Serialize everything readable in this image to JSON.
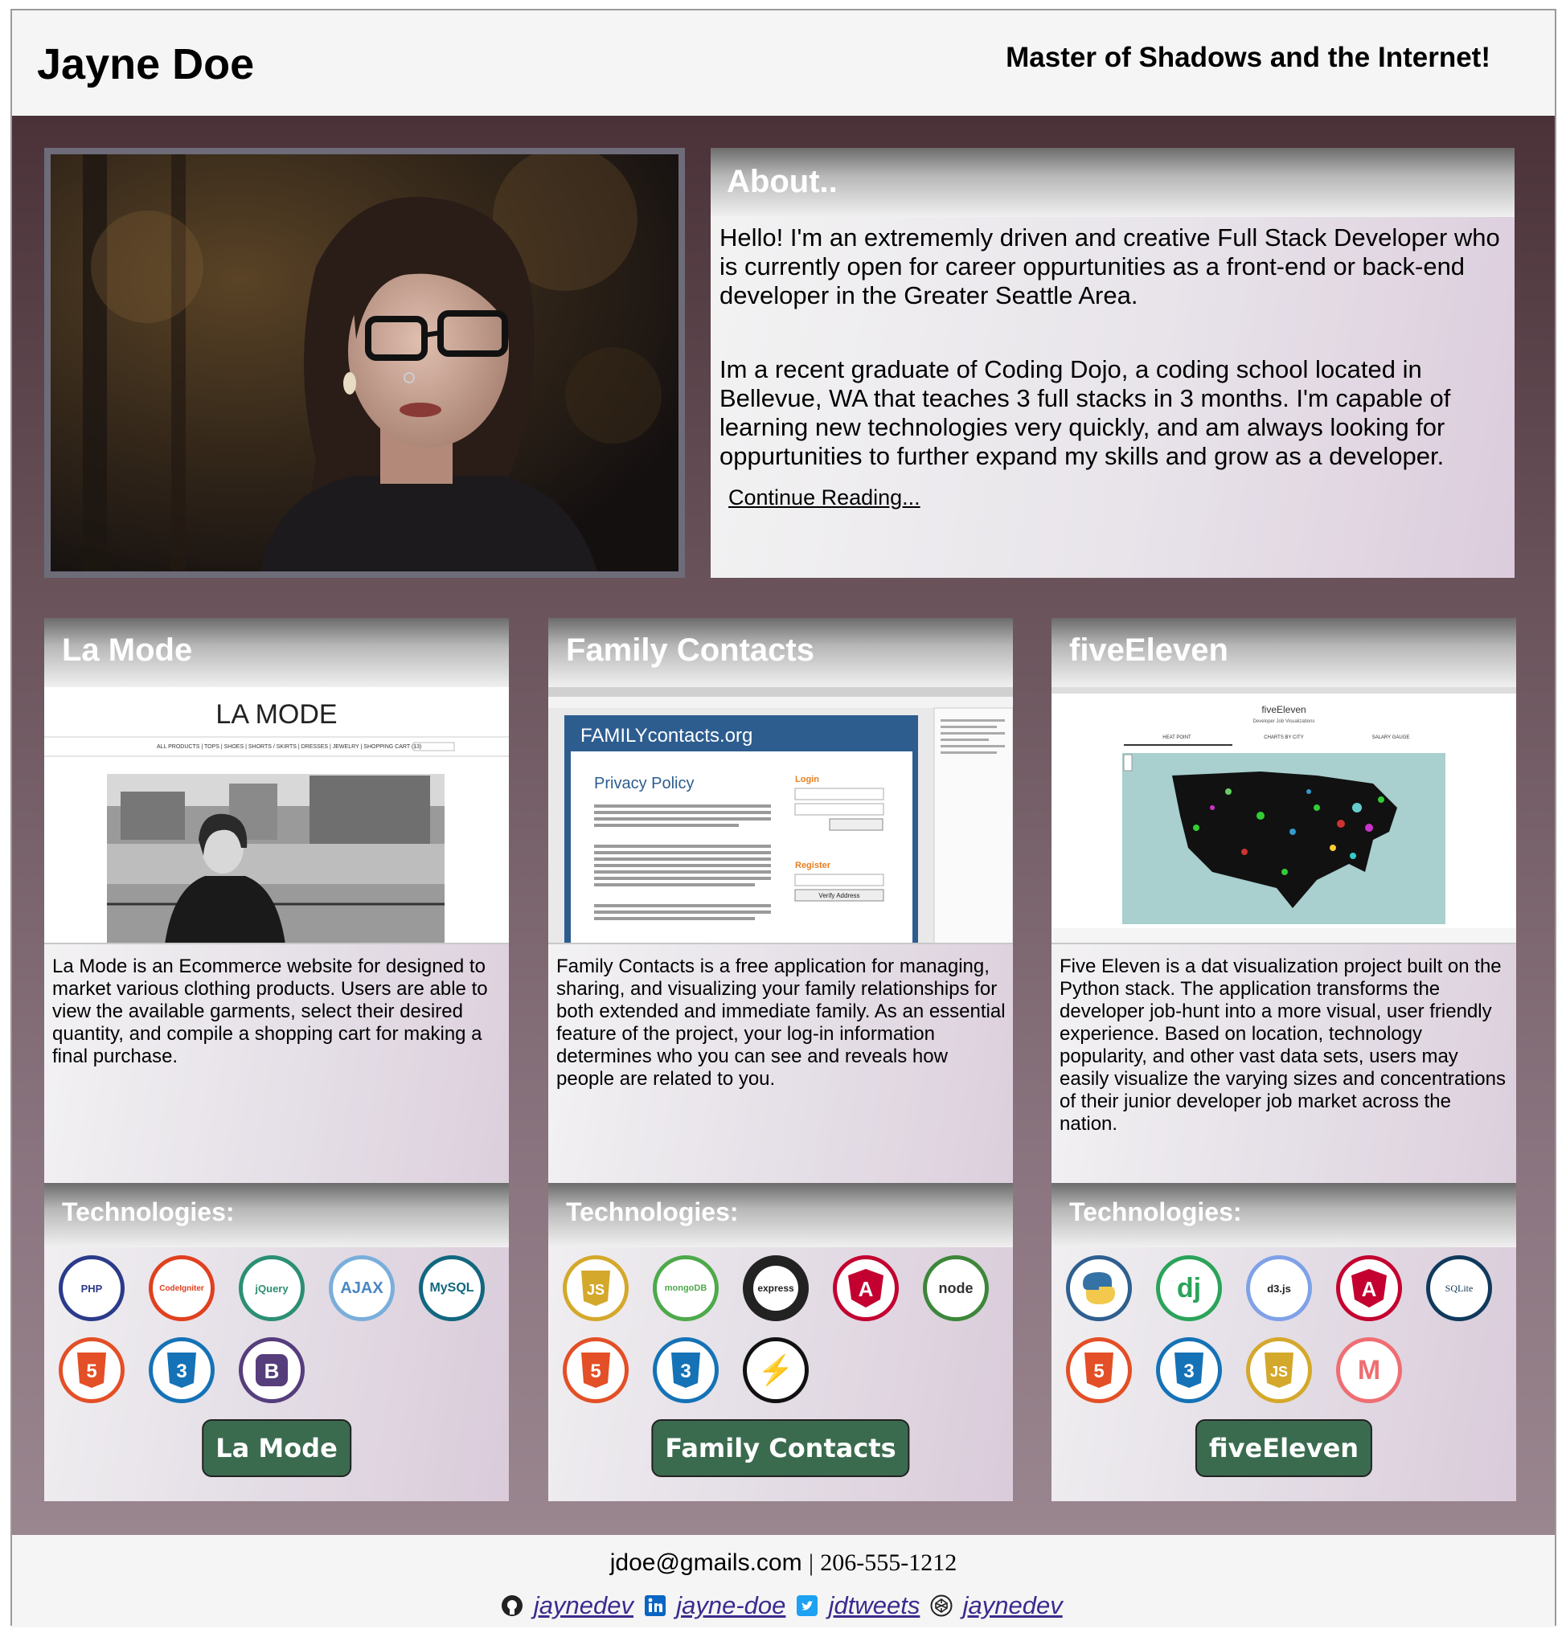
{
  "header": {
    "name": "Jayne Doe",
    "tagline": "Master of Shadows and the Internet!"
  },
  "about": {
    "title": "About..",
    "p1": "Hello! I'm an extrememly driven and creative Full Stack Developer who is currently open for career oppurtunities as a front-end or back-end developer in the Greater Seattle Area.",
    "p2": "Im a recent graduate of Coding Dojo, a coding school located in Bellevue, WA that teaches 3 full stacks in 3 months. I'm capable of learning new technologies very quickly, and am always looking for oppurtunities to further expand my skills and grow as a developer.",
    "continue": "Continue Reading..."
  },
  "projects": [
    {
      "title": "La Mode",
      "description": "La Mode is an Ecommerce website for designed to market various clothing products. Users are able to view the available garments, select their desired quantity, and compile a shopping cart for making a final purchase.",
      "tech_label": "Technologies:",
      "button": "La Mode",
      "screenshot": {
        "brand": "LA MODE",
        "nav": "ALL PRODUCTS | TOPS | SHOES | SHORTS / SKIRTS | DRESSES | JEWELRY | SHOPPING CART (13)"
      },
      "technologies": [
        {
          "name": "php-icon",
          "label": "PHP",
          "color": "#2b3a8a"
        },
        {
          "name": "codeigniter-icon",
          "label": "CodeIgniter",
          "color": "#e0401f"
        },
        {
          "name": "jquery-icon",
          "label": "jQuery",
          "color": "#2b8f73"
        },
        {
          "name": "ajax-icon",
          "label": "AJAX",
          "color": "#5a9bd5"
        },
        {
          "name": "mysql-icon",
          "label": "MySQL",
          "color": "#12677f"
        },
        {
          "name": "html5-icon",
          "label": "5",
          "color": "#e34f26"
        },
        {
          "name": "css3-icon",
          "label": "3",
          "color": "#1572b6"
        },
        {
          "name": "bootstrap-icon",
          "label": "B",
          "color": "#563d7c"
        }
      ]
    },
    {
      "title": "Family Contacts",
      "description": "Family Contacts is a free application for managing, sharing, and visualizing your family relationships for both extended and immediate family. As an essential feature of the project, your log-in information determines who you can see and reveals how people are related to you.",
      "tech_label": "Technologies:",
      "button": "Family Contacts",
      "screenshot": {
        "brand": "FAMILYcontacts.org",
        "heading": "Privacy Policy",
        "login": "Login",
        "register": "Register",
        "verify": "Verify Address"
      },
      "technologies": [
        {
          "name": "javascript-icon",
          "label": "JS",
          "color": "#d4a82b"
        },
        {
          "name": "mongodb-icon",
          "label": "mongoDB",
          "color": "#4ea94b"
        },
        {
          "name": "express-icon",
          "label": "express",
          "color": "#222222"
        },
        {
          "name": "angular-icon",
          "label": "A",
          "color": "#c3002f"
        },
        {
          "name": "node-icon",
          "label": "node",
          "color": "#3c873a"
        },
        {
          "name": "html5-icon",
          "label": "5",
          "color": "#e34f26"
        },
        {
          "name": "css3-icon",
          "label": "3",
          "color": "#1572b6"
        },
        {
          "name": "socketio-icon",
          "label": "⚡",
          "color": "#111111"
        }
      ]
    },
    {
      "title": "fiveEleven",
      "description": "Five Eleven is a dat visualization project built on the Python stack. The application transforms the developer job-hunt into a more visual, user friendly experience. Based on location, technology popularity, and other vast data sets, users may easily visualize the varying sizes and concentrations of their junior developer job market across the nation.",
      "tech_label": "Technologies:",
      "button": "fiveEleven",
      "screenshot": {
        "brand": "fiveEleven",
        "sub": "Developer Job Visualizations",
        "tabs": [
          "HEAT POINT",
          "CHARTS BY CITY",
          "SALARY GAUGE"
        ]
      },
      "technologies": [
        {
          "name": "python-icon",
          "label": "Py",
          "color": "#2f5f8f"
        },
        {
          "name": "django-icon",
          "label": "dj",
          "color": "#2ba35a"
        },
        {
          "name": "d3-icon",
          "label": "d3.js",
          "color": "#7fa1e8"
        },
        {
          "name": "angular-icon",
          "label": "A",
          "color": "#c3002f"
        },
        {
          "name": "sqlite-icon",
          "label": "SQLite",
          "color": "#0f3a5c"
        },
        {
          "name": "html5-icon",
          "label": "5",
          "color": "#e34f26"
        },
        {
          "name": "css3-icon",
          "label": "3",
          "color": "#1572b6"
        },
        {
          "name": "javascript-icon",
          "label": "JS",
          "color": "#d4a82b"
        },
        {
          "name": "materialize-icon",
          "label": "M",
          "color": "#ee6e73"
        }
      ]
    }
  ],
  "footer": {
    "email": "jdoe@gmails.com",
    "separator": "|",
    "phone": "206-555-1212",
    "socials": [
      {
        "name": "github-icon",
        "handle": "jaynedev"
      },
      {
        "name": "linkedin-icon",
        "handle": "jayne-doe"
      },
      {
        "name": "twitter-icon",
        "handle": "jdtweets"
      },
      {
        "name": "codepen-icon",
        "handle": "jaynedev"
      }
    ]
  },
  "colors": {
    "header_bg": "#f5f5f5",
    "main_top": "#4a3238",
    "main_bottom": "#9a868f",
    "button_green": "#3b6b4f",
    "link": "#3b2a8e"
  }
}
